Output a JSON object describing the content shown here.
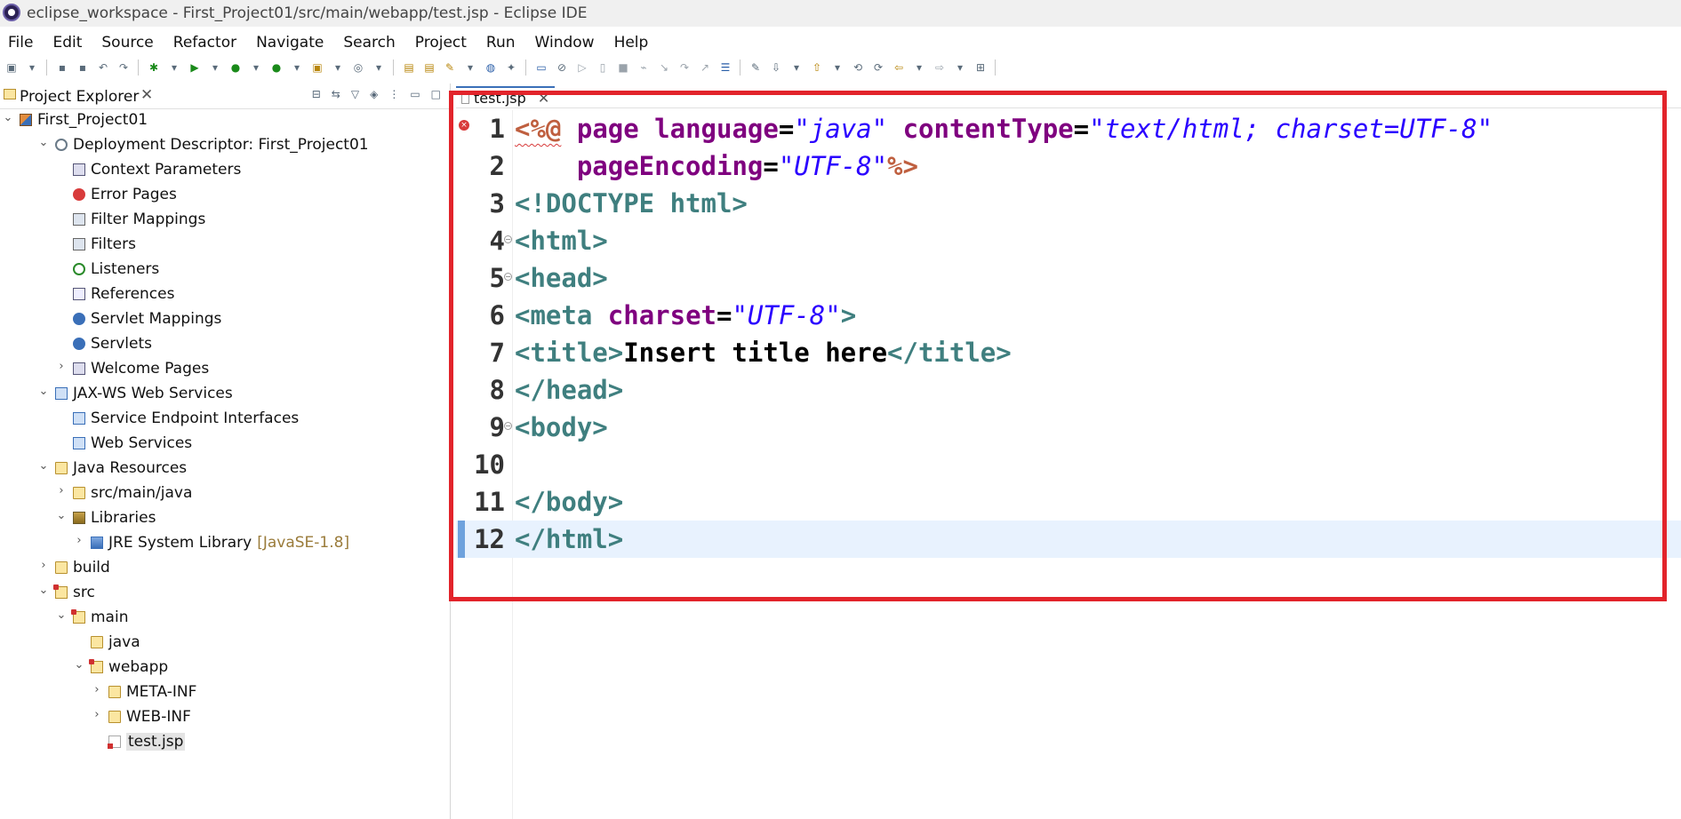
{
  "window": {
    "title": "eclipse_workspace - First_Project01/src/main/webapp/test.jsp - Eclipse IDE"
  },
  "menu": [
    "File",
    "Edit",
    "Source",
    "Refactor",
    "Navigate",
    "Search",
    "Project",
    "Run",
    "Window",
    "Help"
  ],
  "toolbar": {
    "icons": [
      "new-icon",
      "dropdown-icon",
      "save-icon",
      "save-all-icon",
      "undo-icon",
      "redo-icon",
      "debug-icon",
      "dropdown-icon",
      "run-icon",
      "dropdown-icon",
      "coverage-icon",
      "dropdown-icon",
      "external-tools-icon",
      "dropdown-icon",
      "new-server-icon",
      "dropdown-icon",
      "new-web-service-icon",
      "dropdown-icon",
      "open-type-icon",
      "open-task-icon",
      "search-icon",
      "dropdown-icon",
      "globe-icon",
      "git-icon",
      "monitor-icon",
      "skip-breakpoints-icon",
      "resume-icon",
      "suspend-icon",
      "terminate-icon",
      "disconnect-icon",
      "step-into-icon",
      "step-over-icon",
      "step-return-icon",
      "annotation-icon",
      "mark-occurrences-icon",
      "next-annotation-icon",
      "dropdown-icon",
      "previous-annotation-icon",
      "dropdown-icon",
      "back-icon",
      "forward-icon",
      "back-history-icon",
      "dropdown-icon",
      "forward-history-icon",
      "dropdown-icon",
      "open-perspective-icon"
    ]
  },
  "explorer": {
    "title": "Project Explorer",
    "close": "✕",
    "tree": [
      {
        "label": "First_Project01",
        "depth": 0,
        "twisty": "open",
        "icon": "project"
      },
      {
        "label": "Deployment Descriptor: First_Project01",
        "depth": 1,
        "twisty": "open",
        "icon": "gear"
      },
      {
        "label": "Context Parameters",
        "depth": 2,
        "twisty": "",
        "icon": "page"
      },
      {
        "label": "Error Pages",
        "depth": 2,
        "twisty": "",
        "icon": "error"
      },
      {
        "label": "Filter Mappings",
        "depth": 2,
        "twisty": "",
        "icon": "filter"
      },
      {
        "label": "Filters",
        "depth": 2,
        "twisty": "",
        "icon": "filter"
      },
      {
        "label": "Listeners",
        "depth": 2,
        "twisty": "",
        "icon": "listener"
      },
      {
        "label": "References",
        "depth": 2,
        "twisty": "",
        "icon": "ref"
      },
      {
        "label": "Servlet Mappings",
        "depth": 2,
        "twisty": "",
        "icon": "servlet"
      },
      {
        "label": "Servlets",
        "depth": 2,
        "twisty": "",
        "icon": "servlet"
      },
      {
        "label": "Welcome Pages",
        "depth": 2,
        "twisty": "closed",
        "icon": "page"
      },
      {
        "label": "JAX-WS Web Services",
        "depth": 1,
        "twisty": "open",
        "icon": "ws"
      },
      {
        "label": "Service Endpoint Interfaces",
        "depth": 2,
        "twisty": "",
        "icon": "ws"
      },
      {
        "label": "Web Services",
        "depth": 2,
        "twisty": "",
        "icon": "ws"
      },
      {
        "label": "Java Resources",
        "depth": 1,
        "twisty": "open",
        "icon": "folder"
      },
      {
        "label": "src/main/java",
        "depth": 2,
        "twisty": "closed",
        "icon": "folder"
      },
      {
        "label": "Libraries",
        "depth": 2,
        "twisty": "open",
        "icon": "lib"
      },
      {
        "label": "JRE System Library",
        "deco": "[JavaSE-1.8]",
        "depth": 3,
        "twisty": "closed",
        "icon": "jre"
      },
      {
        "label": "build",
        "depth": 1,
        "twisty": "closed",
        "icon": "folder"
      },
      {
        "label": "src",
        "depth": 1,
        "twisty": "open",
        "icon": "src-folder"
      },
      {
        "label": "main",
        "depth": 2,
        "twisty": "open",
        "icon": "src-folder"
      },
      {
        "label": "java",
        "depth": 3,
        "twisty": "",
        "icon": "folder"
      },
      {
        "label": "webapp",
        "depth": 3,
        "twisty": "open",
        "icon": "src-folder"
      },
      {
        "label": "META-INF",
        "depth": 4,
        "twisty": "closed",
        "icon": "folder"
      },
      {
        "label": "WEB-INF",
        "depth": 4,
        "twisty": "closed",
        "icon": "folder"
      },
      {
        "label": "test.jsp",
        "depth": 4,
        "twisty": "",
        "icon": "jsp",
        "selected": true
      }
    ]
  },
  "editor": {
    "tab": {
      "label": "test.jsp",
      "close": "✕"
    },
    "current_line": 12,
    "lines": [
      {
        "num": "1",
        "error": true,
        "fold": false,
        "tokens": [
          [
            "dir",
            "<%@"
          ],
          [
            "text",
            " "
          ],
          [
            "attr",
            "page"
          ],
          [
            "text",
            " "
          ],
          [
            "attr",
            "language"
          ],
          [
            "eq",
            "="
          ],
          [
            "str",
            "\"java\""
          ],
          [
            "text",
            " "
          ],
          [
            "attr",
            "contentType"
          ],
          [
            "eq",
            "="
          ],
          [
            "str",
            "\"text/html; charset=UTF-8\""
          ]
        ]
      },
      {
        "num": "2",
        "error": false,
        "fold": false,
        "tokens": [
          [
            "text",
            "    "
          ],
          [
            "attr",
            "pageEncoding"
          ],
          [
            "eq",
            "="
          ],
          [
            "str",
            "\"UTF-8\""
          ],
          [
            "dir",
            "%>"
          ]
        ]
      },
      {
        "num": "3",
        "error": false,
        "fold": false,
        "tokens": [
          [
            "tag",
            "<!DOCTYPE html>"
          ]
        ]
      },
      {
        "num": "4",
        "error": false,
        "fold": true,
        "tokens": [
          [
            "tag",
            "<html>"
          ]
        ]
      },
      {
        "num": "5",
        "error": false,
        "fold": true,
        "tokens": [
          [
            "tag",
            "<head>"
          ]
        ]
      },
      {
        "num": "6",
        "error": false,
        "fold": false,
        "tokens": [
          [
            "tag",
            "<meta"
          ],
          [
            "text",
            " "
          ],
          [
            "attr",
            "charset"
          ],
          [
            "eq",
            "="
          ],
          [
            "str",
            "\"UTF-8\""
          ],
          [
            "tag",
            ">"
          ]
        ]
      },
      {
        "num": "7",
        "error": false,
        "fold": false,
        "tokens": [
          [
            "tag",
            "<title>"
          ],
          [
            "text",
            "Insert title here"
          ],
          [
            "tag",
            "</title>"
          ]
        ]
      },
      {
        "num": "8",
        "error": false,
        "fold": false,
        "tokens": [
          [
            "tag",
            "</head>"
          ]
        ]
      },
      {
        "num": "9",
        "error": false,
        "fold": true,
        "tokens": [
          [
            "tag",
            "<body>"
          ]
        ]
      },
      {
        "num": "10",
        "error": false,
        "fold": false,
        "tokens": []
      },
      {
        "num": "11",
        "error": false,
        "fold": false,
        "tokens": [
          [
            "tag",
            "</body>"
          ]
        ]
      },
      {
        "num": "12",
        "error": false,
        "fold": false,
        "tokens": [
          [
            "tag",
            "</html>"
          ]
        ]
      }
    ]
  },
  "colors": {
    "highlight_box": "#e2242b",
    "current_line": "#e8f2fe",
    "directive": "#bf5f3f",
    "attribute": "#7f007f",
    "string": "#2a00ff",
    "tag": "#3f7f7f"
  }
}
